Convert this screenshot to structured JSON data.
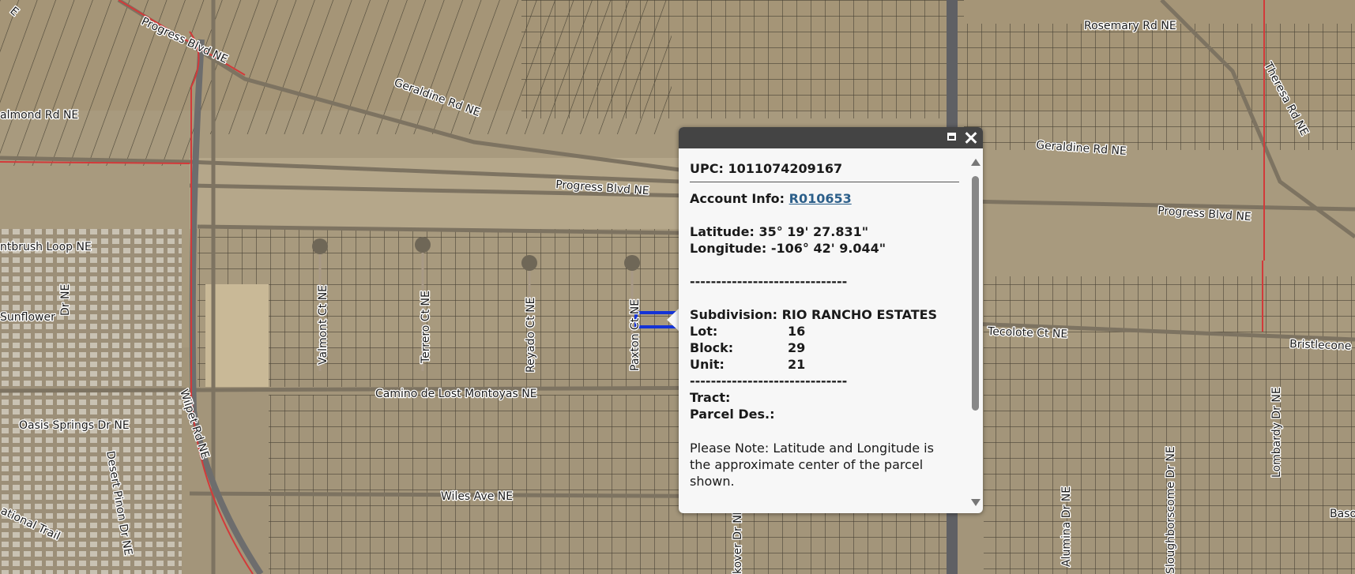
{
  "map": {
    "road_labels": [
      "Progress Blvd NE",
      "Geraldine Rd NE",
      "almond Rd NE",
      "Progress Blvd NE",
      "Rosemary Rd NE",
      "Theresa Rd NE",
      "Geraldine Rd NE",
      "Progress Blvd NE",
      "ntbrush Loop NE",
      "Dr NE",
      "Sunflower",
      "Valmont Ct NE",
      "Terrero Ct NE",
      "Reyado Ct NE",
      "Paxton Ct NE",
      "Tecolote Ct NE",
      "Bristlecone",
      "Camino de Lost Montoyas NE",
      "Oasis Springs Dr NE",
      "Wilpet Rd NE",
      "Desert Pinon Dr NE",
      "Wiles Ave NE",
      "Alumina Dr NE",
      "Sloughborscome Dr NE",
      "Lombardy Dr NE",
      "Baso",
      "ational Trail",
      "E",
      "kover Dr NE"
    ],
    "colors": {
      "terrain": "#a89a7e",
      "parcel_lines": "#4a4436",
      "boundary": "#d23a3a",
      "selected_parcel": "#1433d6"
    }
  },
  "popup": {
    "controls": {
      "maximize_icon": "maximize-icon",
      "close_icon": "close-icon"
    },
    "upc_label": "UPC:",
    "upc_value": "1011074209167",
    "account_label": "Account Info:",
    "account_value": "R010653",
    "latitude_label": "Latitude:",
    "latitude_value": "35° 19' 27.831\"",
    "longitude_label": "Longitude:",
    "longitude_value": "-106° 42' 9.044\"",
    "dashes": "------------------------------",
    "subdivision_label": "Subdivision:",
    "subdivision_value": "RIO RANCHO ESTATES",
    "lot_label": "Lot:",
    "lot_value": "16",
    "block_label": "Block:",
    "block_value": "29",
    "unit_label": "Unit:",
    "unit_value": "21",
    "tract_label": "Tract:",
    "parcel_des_label": "Parcel Des.:",
    "note": "Please Note: Latitude and Longitude is the approximate center of the parcel shown."
  }
}
